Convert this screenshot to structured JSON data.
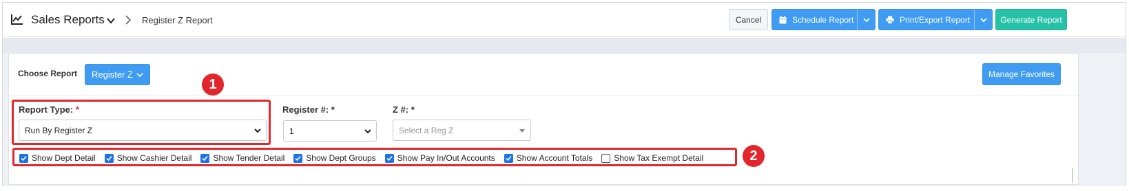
{
  "header": {
    "title": "Sales Reports",
    "breadcrumb": "Register Z Report",
    "cancel_label": "Cancel",
    "schedule_label": "Schedule Report",
    "print_label": "Print/Export Report",
    "generate_label": "Generate Report"
  },
  "panel": {
    "choose_label": "Choose Report",
    "report_button_label": "Register Z",
    "favorites_label": "Manage Favorites",
    "report_type": {
      "label": "Report Type:",
      "required": "*",
      "value": "Run By Register Z"
    },
    "register": {
      "label": "Register #: *",
      "value": "1"
    },
    "z": {
      "label": "Z #: *",
      "placeholder": "Select a Reg Z"
    },
    "checkboxes": [
      {
        "label": "Show Dept Detail",
        "checked": true
      },
      {
        "label": "Show Cashier Detail",
        "checked": true
      },
      {
        "label": "Show Tender Detail",
        "checked": true
      },
      {
        "label": "Show Dept Groups",
        "checked": true
      },
      {
        "label": "Show Pay In/Out Accounts",
        "checked": true
      },
      {
        "label": "Show Account Totals",
        "checked": true
      },
      {
        "label": "Show Tax Exempt Detail",
        "checked": false
      }
    ]
  },
  "annotations": {
    "one": "1",
    "two": "2"
  },
  "colors": {
    "primary": "#3f9cf2",
    "teal": "#25c2a8",
    "annotation": "#e3262b"
  }
}
